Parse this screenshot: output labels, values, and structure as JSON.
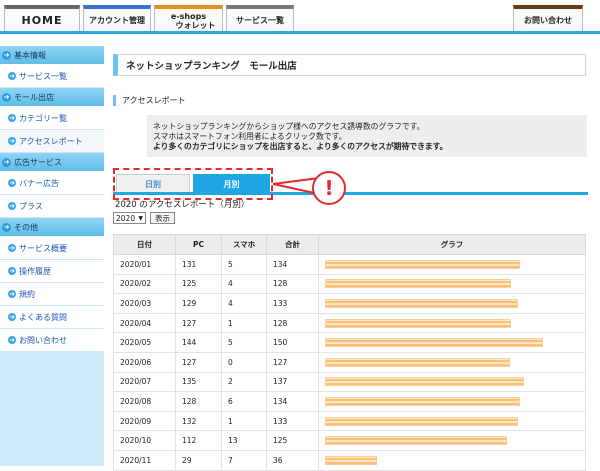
{
  "topnav": {
    "home": "HOME",
    "account": "アカウント管理",
    "wallet_line1": "e-shops",
    "wallet_line2": "ウォレット",
    "service": "サービス一覧",
    "contact": "お問い合わせ"
  },
  "sidebar": [
    {
      "heading": "基本情報",
      "items": [
        "サービス一覧"
      ]
    },
    {
      "heading": "モール出店",
      "items": [
        "カテゴリー覧",
        "アクセスレポート"
      ]
    },
    {
      "heading": "広告サービス",
      "items": [
        "バナー広告",
        "プラス"
      ]
    },
    {
      "heading": "その他",
      "items": [
        "サービス概要",
        "操作履歴",
        "規約",
        "よくある質問",
        "お問い合わせ"
      ]
    }
  ],
  "page": {
    "title": "ネットショップランキング　モール出店",
    "subtitle": "アクセスレポート",
    "info_line1": "ネットショップランキングからショップ様へのアクセス誘導数のグラフです。",
    "info_line2": "スマホはスマートフォン利用者によるクリック数です。",
    "info_line3": "より多くのカテゴリにショップを出店すると、より多くのアクセスが期待できます。",
    "tab_daily": "日別",
    "tab_monthly": "月別",
    "callout_mark": "!",
    "report_title": "2020 のアクセスレポート（月別）",
    "year_select": "2020",
    "show_button": "表示"
  },
  "chart_data": {
    "type": "table",
    "columns": [
      "日付",
      "PC",
      "スマホ",
      "合計",
      "グラフ"
    ],
    "rows": [
      {
        "date": "2020/01",
        "pc": 131,
        "sp": 5,
        "total": 134
      },
      {
        "date": "2020/02",
        "pc": 125,
        "sp": 4,
        "total": 128
      },
      {
        "date": "2020/03",
        "pc": 129,
        "sp": 4,
        "total": 133
      },
      {
        "date": "2020/04",
        "pc": 127,
        "sp": 1,
        "total": 128
      },
      {
        "date": "2020/05",
        "pc": 144,
        "sp": 5,
        "total": 150
      },
      {
        "date": "2020/06",
        "pc": 127,
        "sp": 0,
        "total": 127
      },
      {
        "date": "2020/07",
        "pc": 135,
        "sp": 2,
        "total": 137
      },
      {
        "date": "2020/08",
        "pc": 128,
        "sp": 6,
        "total": 134
      },
      {
        "date": "2020/09",
        "pc": 132,
        "sp": 1,
        "total": 133
      },
      {
        "date": "2020/10",
        "pc": 112,
        "sp": 13,
        "total": 125
      },
      {
        "date": "2020/11",
        "pc": 29,
        "sp": 7,
        "total": 36
      }
    ],
    "bar_max": 150
  },
  "colors": {
    "accent": "#1ea7e4",
    "callout": "#e32b2b",
    "bar": "#ffbe78"
  }
}
